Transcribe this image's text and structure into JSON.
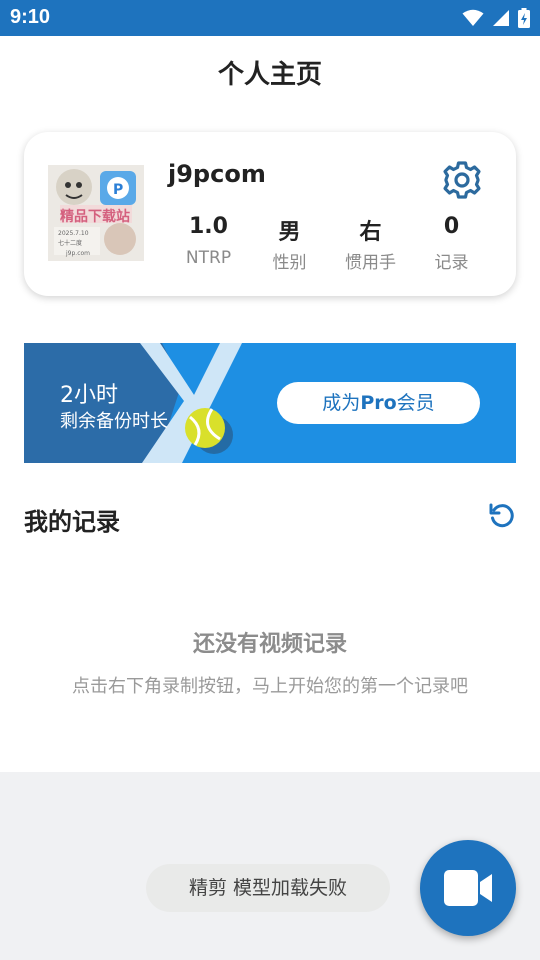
{
  "status_bar": {
    "time": "9:10"
  },
  "header": {
    "title": "个人主页"
  },
  "profile": {
    "username": "j9pcom",
    "avatar_caption": "精品下载站",
    "stats": [
      {
        "value": "1.0",
        "label": "NTRP"
      },
      {
        "value": "男",
        "label": "性别"
      },
      {
        "value": "右",
        "label": "惯用手"
      },
      {
        "value": "0",
        "label": "记录"
      }
    ]
  },
  "banner": {
    "hours": "2小时",
    "subtitle": "剩余备份时长",
    "button_prefix": "成为",
    "button_bold": "Pro",
    "button_suffix": "会员"
  },
  "records": {
    "title": "我的记录",
    "empty_title": "还没有视频记录",
    "empty_subtitle": "点击右下角录制按钮，马上开始您的第一个记录吧"
  },
  "toast": {
    "text": "精剪 模型加载失败"
  },
  "colors": {
    "primary": "#1e73be",
    "banner": "#1e8fe3",
    "background_bottom": "#f0f1f3"
  }
}
